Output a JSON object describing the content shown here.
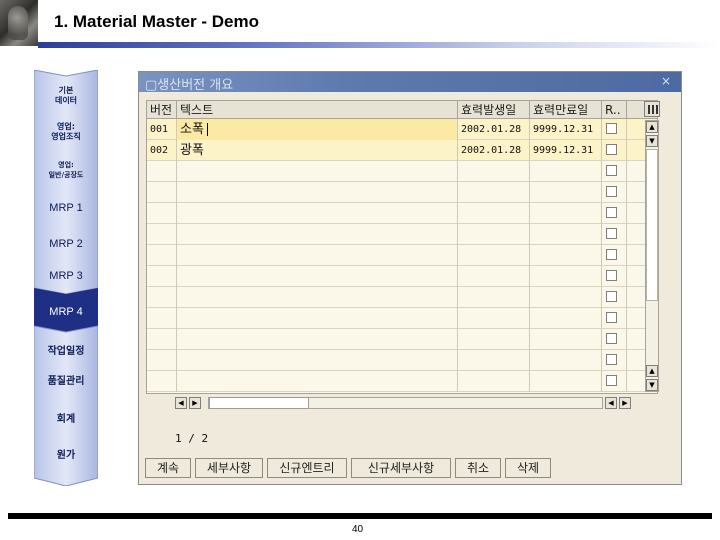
{
  "slide": {
    "title": "1. Material Master - Demo",
    "page_number": "40"
  },
  "nav": {
    "items": [
      {
        "label": "기본\n데이터"
      },
      {
        "label": "영업:\n영업조직"
      },
      {
        "label": "영업:\n일반/공장도"
      },
      {
        "label": "MRP 1"
      },
      {
        "label": "MRP 2"
      },
      {
        "label": "MRP 3"
      },
      {
        "label": "MRP 4",
        "active": true
      },
      {
        "label": "작업일정"
      },
      {
        "label": "품질관리"
      },
      {
        "label": "회계"
      },
      {
        "label": "원가"
      }
    ]
  },
  "window": {
    "title": "생산버전 개요",
    "close": "×",
    "columns": [
      "버전",
      "텍스트",
      "효력발생일",
      "효력만료일",
      "R.."
    ],
    "rows": [
      {
        "version": "001",
        "text": "소폭",
        "valid_from": "2002.01.28",
        "valid_to": "9999.12.31"
      },
      {
        "version": "002",
        "text": "광폭",
        "valid_from": "2002.01.28",
        "valid_to": "9999.12.31"
      }
    ],
    "pager": "1 / 2",
    "buttons": [
      "계속",
      "세부사항",
      "신규엔트리",
      "신규세부사항",
      "취소",
      "삭제"
    ]
  },
  "colors": {
    "titlebar": "#5d79ad",
    "nav_active": "#1f2f86",
    "row_selected": "#fdf3c9"
  }
}
